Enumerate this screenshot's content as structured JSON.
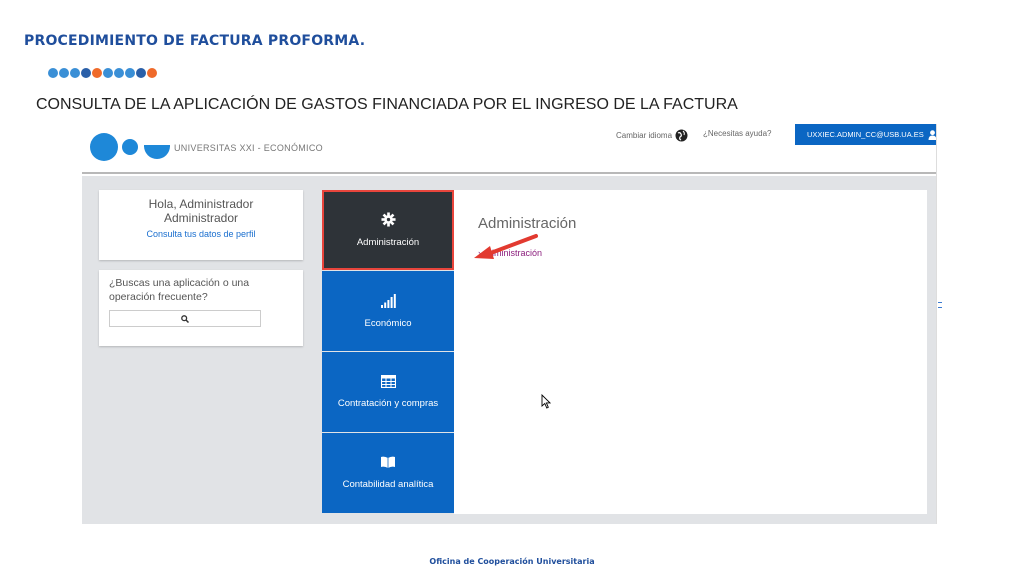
{
  "slide": {
    "title": "PROCEDIMIENTO DE FACTURA PROFORMA.",
    "subtitle": "CONSULTA DE LA APLICACIÓN DE GASTOS FINANCIADA POR EL INGRESO DE LA FACTURA",
    "footer": "Oficina de Cooperación Universitaria",
    "dot_colors": [
      "#3a8fd6",
      "#3a8fd6",
      "#3a8fd6",
      "#2a5fa8",
      "#ef6a2a",
      "#3a8fd6",
      "#3a8fd6",
      "#3a8fd6",
      "#2a5fa8",
      "#ef6a2a"
    ]
  },
  "header": {
    "brand": "UNIVERSITAS XXI - ECONÓMICO",
    "change_language": "Cambiar idioma",
    "help": "¿Necesitas ayuda?",
    "user": "UXXIEC.ADMIN_CC@USB.UA.ES"
  },
  "greeting": {
    "line1": "Hola, Administrador",
    "line2": "Administrador",
    "profile_link": "Consulta tus datos de perfil"
  },
  "search": {
    "question": "¿Buscas una aplicación o una operación frecuente?",
    "placeholder": ""
  },
  "tiles": [
    {
      "label": "Administración",
      "icon": "gear-icon",
      "active": true
    },
    {
      "label": "Económico",
      "icon": "signal-bars-icon",
      "active": false
    },
    {
      "label": "Contratación y compras",
      "icon": "table-icon",
      "active": false
    },
    {
      "label": "Contabilidad analítica",
      "icon": "book-icon",
      "active": false
    }
  ],
  "panel": {
    "title": "Administración",
    "link": "› Administración"
  },
  "colors": {
    "primary_blue": "#0b66c3",
    "active_tile": "#2e3338",
    "highlight_red": "#e8453c",
    "slide_title": "#1f4e9c"
  }
}
